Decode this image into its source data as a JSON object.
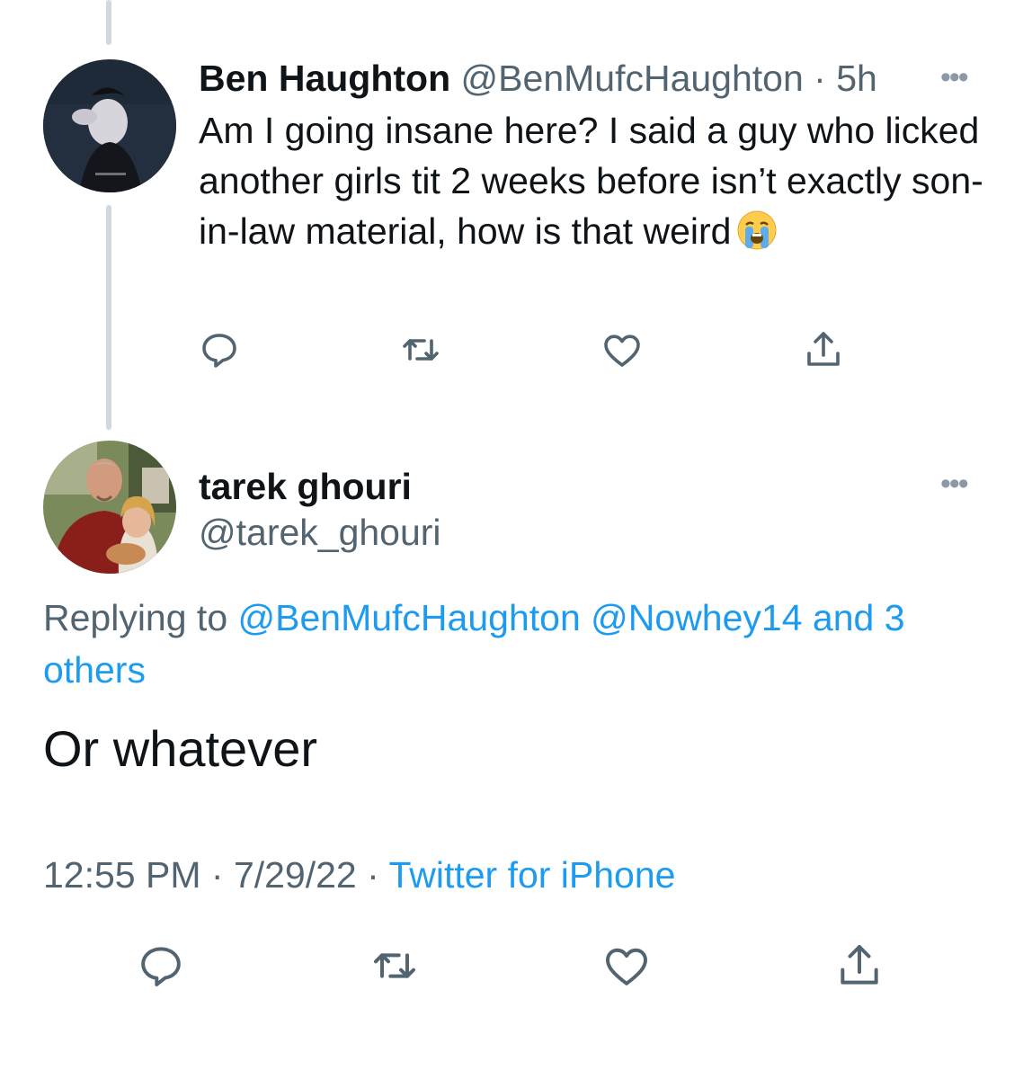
{
  "tweet1": {
    "author_name": "Ben Haughton",
    "author_handle": "@BenMufcHaughton",
    "separator": " · ",
    "time": "5h",
    "more": "•••",
    "text": "Am I going insane here? I said a guy who licked another girls tit 2 weeks before isn’t exactly son-in-law material, how is that weird",
    "emoji": "loudly-crying-face-icon"
  },
  "tweet2": {
    "author_name": "tarek ghouri",
    "author_handle": "@tarek_ghouri",
    "more": "•••",
    "replying_prefix": "Replying to ",
    "mention1": "@BenMufcHaughton",
    "mention2": "@Nowhey14",
    "and_others": "and 3 others",
    "text": "Or whatever",
    "time": "12:55 PM",
    "sep1": " · ",
    "date": "7/29/22",
    "sep2": " · ",
    "source": "Twitter for iPhone"
  },
  "actions": [
    "reply-icon",
    "retweet-icon",
    "like-icon",
    "share-icon"
  ],
  "colors": {
    "link": "#1d9bf0",
    "secondary": "#536471",
    "thread_line": "#cfd9de",
    "icon": "#536471"
  }
}
